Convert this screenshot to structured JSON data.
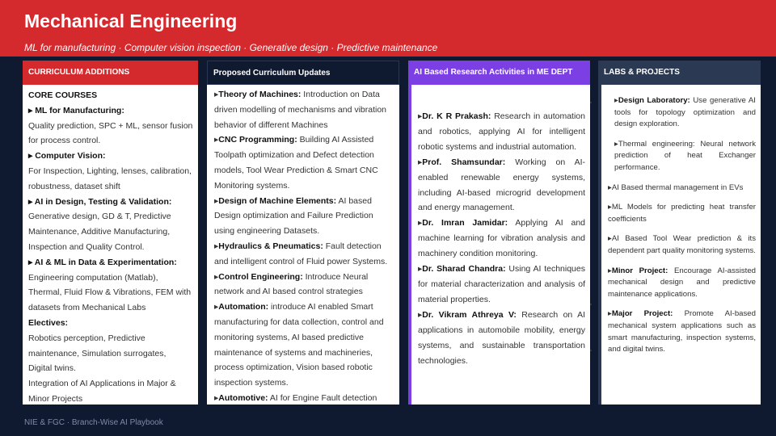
{
  "header": {
    "title": "Mechanical Engineering",
    "subtitle": "ML for manufacturing · Computer vision inspection · Generative design · Predictive maintenance"
  },
  "col1": {
    "heading": "CURRICULUM ADDITIONS",
    "lines": [
      {
        "text": "CORE COURSES",
        "bold": true
      },
      {
        "text": "▸ ML for Manufacturing:",
        "bold": true
      },
      {
        "text": "Quality prediction, SPC + ML, sensor fusion",
        "bold": false
      },
      {
        "text": "for process control.",
        "bold": false
      },
      {
        "text": "▸ Computer Vision:",
        "bold": true
      },
      {
        "text": "For Inspection, Lighting, lenses, calibration,",
        "bold": false
      },
      {
        "text": "robustness, dataset shift",
        "bold": false
      },
      {
        "text": "▸ AI in Design, Testing & Validation:",
        "bold": true
      },
      {
        "text": "Generative design, GD & T, Predictive",
        "bold": false
      },
      {
        "text": "Maintenance, Additive Manufacturing,",
        "bold": false
      },
      {
        "text": "Inspection and Quality Control.",
        "bold": false
      },
      {
        "text": "▸ AI & ML in Data & Experimentation:",
        "bold": true
      },
      {
        "text": "Engineering computation (Matlab),",
        "bold": false
      },
      {
        "text": "Thermal, Fluid Flow & Vibrations, FEM with",
        "bold": false
      },
      {
        "text": "datasets from Mechanical Labs",
        "bold": false
      },
      {
        "text": "Electives:",
        "bold": true
      },
      {
        "text": "Robotics perception, Predictive",
        "bold": false
      },
      {
        "text": "maintenance, Simulation surrogates,",
        "bold": false
      },
      {
        "text": "Digital twins.",
        "bold": false
      },
      {
        "text": "Integration of AI Applications in Major &",
        "bold": false
      },
      {
        "text": "Minor Projects",
        "bold": false
      }
    ]
  },
  "col2": {
    "heading": "Proposed Curriculum Updates",
    "items": [
      {
        "title": "Theory of Machines:",
        "text": " Introduction on Data driven modelling of mechanisms and vibration behavior of different Machines"
      },
      {
        "title": "CNC Programming:",
        "text": " Building AI Assisted Toolpath optimization and Defect detection models, Tool Wear Prediction & Smart CNC Monitoring systems."
      },
      {
        "title": "Design of Machine Elements:",
        "text": " AI based Design optimization and Failure Prediction using engineering Datasets."
      },
      {
        "title": "Hydraulics & Pneumatics:",
        "text": " Fault detection and intelligent control of Fluid power Systems."
      },
      {
        "title": "Control Engineering:",
        "text": " Introduce Neural network and AI based control strategies"
      },
      {
        "title": "Automation:",
        "text": " introduce AI enabled Smart manufacturing for data collection, control and monitoring systems, AI based predictive maintenance of systems and machineries, process optimization, Vision based robotic inspection systems."
      },
      {
        "title": "Automotive:",
        "text": " AI for Engine Fault detection"
      }
    ]
  },
  "col3": {
    "heading": "AI Based Research Activities  in ME DEPT",
    "items": [
      {
        "title": "Dr. K R Prakash:",
        "text": " Research in automation and robotics, applying AI for intelligent robotic systems and industrial automation."
      },
      {
        "title": "Prof. Shamsundar:",
        "text": " Working on AI-enabled renewable energy systems, including AI-based microgrid development and energy management."
      },
      {
        "title": "Dr. Imran Jamidar:",
        "text": " Applying AI and machine learning for vibration analysis and machinery condition monitoring."
      },
      {
        "title": "Dr. Sharad Chandra:",
        "text": " Using AI techniques for material characterization and analysis of material properties."
      },
      {
        "title": "Dr. Vikram Athreya V:",
        "text": " Research on AI applications in automobile mobility, energy systems, and sustainable transportation technologies."
      }
    ]
  },
  "col4": {
    "heading": "LABS & PROJECTS",
    "items": [
      {
        "title": "Design Laboratory:",
        "text": " Use generative AI tools for topology optimization and design exploration.",
        "indent": true
      },
      {
        "title": "",
        "text": "Thermal engineering: Neural network prediction of heat Exchanger performance.",
        "indent": true
      },
      {
        "title": "",
        "text": "AI Based thermal management in EVs",
        "indent": false
      },
      {
        "title": "",
        "text": "ML Models for predicting heat transfer coefficients",
        "indent": false
      },
      {
        "title": "",
        "text": "AI Based Tool Wear prediction & its dependent part quality monitoring systems.",
        "indent": false
      },
      {
        "title": "Minor Project:",
        "text": " Encourage AI-assisted mechanical design and predictive maintenance applications.",
        "indent": false
      },
      {
        "title": "Major Project:",
        "text": " Promote AI-based mechanical system applications such as smart manufacturing, inspection systems, and digital twins.",
        "indent": false
      }
    ]
  },
  "footer": "NIE & FGC · Branch-Wise AI Playbook"
}
